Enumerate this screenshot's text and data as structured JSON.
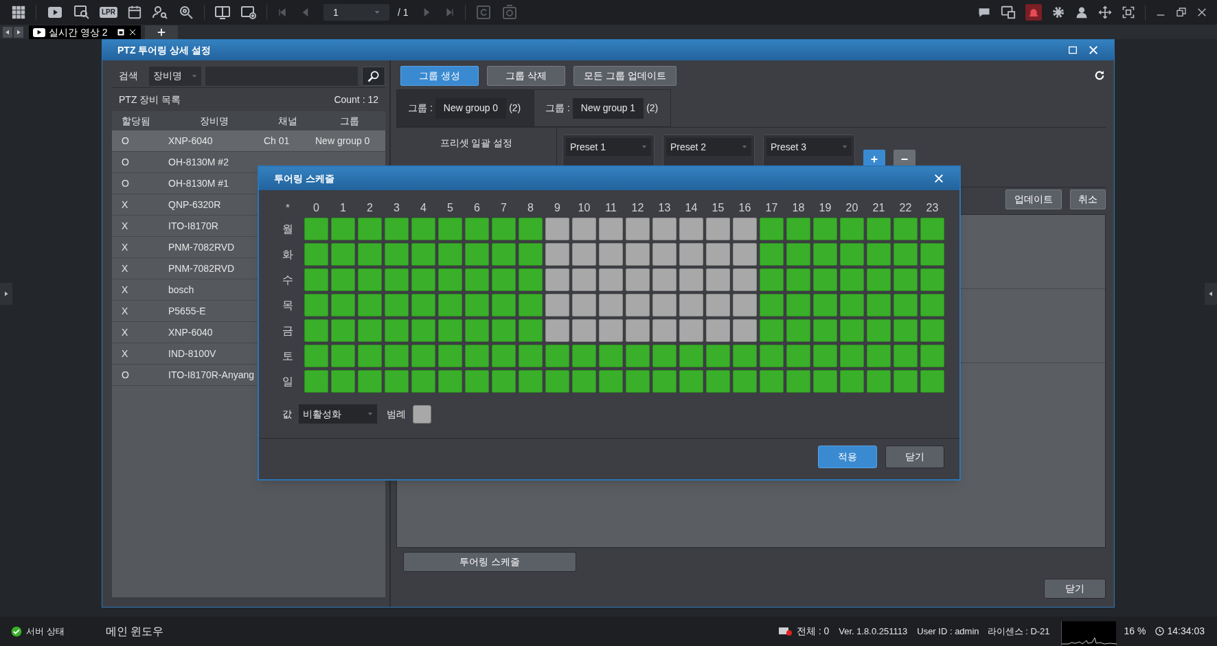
{
  "toolbar": {
    "lpr_label": "LPR",
    "page": "1",
    "page_total": "/ 1"
  },
  "tabs": [
    {
      "label": "실시간 영상 2",
      "selected": true
    }
  ],
  "dialog": {
    "title": "PTZ 투어링 상세 설정",
    "search": {
      "label": "검색",
      "field": "장비명"
    },
    "list_title": "PTZ 장비 목록",
    "count": "Count : 12",
    "columns": [
      "할당됨",
      "장비명",
      "채널",
      "그룹"
    ],
    "rows": [
      {
        "assigned": "O",
        "name": "XNP-6040",
        "channel": "Ch 01",
        "group": "New group 0",
        "selected": true
      },
      {
        "assigned": "O",
        "name": "OH-8130M #2",
        "selected": false
      },
      {
        "assigned": "O",
        "name": "OH-8130M #1",
        "selected": false
      },
      {
        "assigned": "X",
        "name": "QNP-6320R",
        "selected": false
      },
      {
        "assigned": "X",
        "name": "ITO-I8170R",
        "selected": false
      },
      {
        "assigned": "X",
        "name": "PNM-7082RVD",
        "selected": false
      },
      {
        "assigned": "X",
        "name": "PNM-7082RVD",
        "selected": false
      },
      {
        "assigned": "X",
        "name": "bosch",
        "selected": false
      },
      {
        "assigned": "X",
        "name": "P5655-E",
        "selected": false
      },
      {
        "assigned": "X",
        "name": "XNP-6040",
        "selected": false
      },
      {
        "assigned": "X",
        "name": "IND-8100V",
        "selected": false
      },
      {
        "assigned": "O",
        "name": "ITO-I8170R-Anyang",
        "selected": false
      }
    ],
    "buttons": [
      {
        "label": "그룹 생성",
        "primary": true
      },
      {
        "label": "그룹 삭제",
        "primary": false
      },
      {
        "label": "모든 그룹 업데이트",
        "primary": false
      }
    ],
    "groups": [
      {
        "label": "그룹 :",
        "name": "New group 0",
        "count": "(2)",
        "selected": true
      },
      {
        "label": "그룹 :",
        "name": "New group 1",
        "count": "(2)",
        "selected": false
      }
    ],
    "preset_bulk_label": "프리셋 일괄 설정",
    "presets": [
      "Preset 1",
      "Preset 2",
      "Preset 3"
    ],
    "update_button": "업데이트",
    "cancel_button": "취소",
    "tour_schedule_button": "투어링 스케줄",
    "close_button": "닫기"
  },
  "schedule": {
    "title": "투어링 스케줄",
    "corner": "*",
    "hours": [
      "0",
      "1",
      "2",
      "3",
      "4",
      "5",
      "6",
      "7",
      "8",
      "9",
      "10",
      "11",
      "12",
      "13",
      "14",
      "15",
      "16",
      "17",
      "18",
      "19",
      "20",
      "21",
      "22",
      "23"
    ],
    "rows": [
      {
        "day": "월",
        "cells": [
          true,
          true,
          true,
          true,
          true,
          true,
          true,
          true,
          true,
          false,
          false,
          false,
          false,
          false,
          false,
          false,
          false,
          true,
          true,
          true,
          true,
          true,
          true,
          true
        ]
      },
      {
        "day": "화",
        "cells": [
          true,
          true,
          true,
          true,
          true,
          true,
          true,
          true,
          true,
          false,
          false,
          false,
          false,
          false,
          false,
          false,
          false,
          true,
          true,
          true,
          true,
          true,
          true,
          true
        ]
      },
      {
        "day": "수",
        "cells": [
          true,
          true,
          true,
          true,
          true,
          true,
          true,
          true,
          true,
          false,
          false,
          false,
          false,
          false,
          false,
          false,
          false,
          true,
          true,
          true,
          true,
          true,
          true,
          true
        ]
      },
      {
        "day": "목",
        "cells": [
          true,
          true,
          true,
          true,
          true,
          true,
          true,
          true,
          true,
          false,
          false,
          false,
          false,
          false,
          false,
          false,
          false,
          true,
          true,
          true,
          true,
          true,
          true,
          true
        ]
      },
      {
        "day": "금",
        "cells": [
          true,
          true,
          true,
          true,
          true,
          true,
          true,
          true,
          true,
          false,
          false,
          false,
          false,
          false,
          false,
          false,
          false,
          true,
          true,
          true,
          true,
          true,
          true,
          true
        ]
      },
      {
        "day": "토",
        "cells": [
          true,
          true,
          true,
          true,
          true,
          true,
          true,
          true,
          true,
          true,
          true,
          true,
          true,
          true,
          true,
          true,
          true,
          true,
          true,
          true,
          true,
          true,
          true,
          true
        ]
      },
      {
        "day": "일",
        "cells": [
          true,
          true,
          true,
          true,
          true,
          true,
          true,
          true,
          true,
          true,
          true,
          true,
          true,
          true,
          true,
          true,
          true,
          true,
          true,
          true,
          true,
          true,
          true,
          true
        ]
      }
    ],
    "value_label": "값",
    "value": "비활성화",
    "legend_label": "범례",
    "apply_button": "적용",
    "close_button": "닫기"
  },
  "status_bar": {
    "server_status": "서버 상태",
    "window_name": "메인 윈도우",
    "total": "전체 : 0",
    "version": "Ver. 1.8.0.251113",
    "user": "User ID : admin",
    "license": "라이센스 : D-21",
    "cpu": "16 %",
    "time": "14:34:03"
  }
}
